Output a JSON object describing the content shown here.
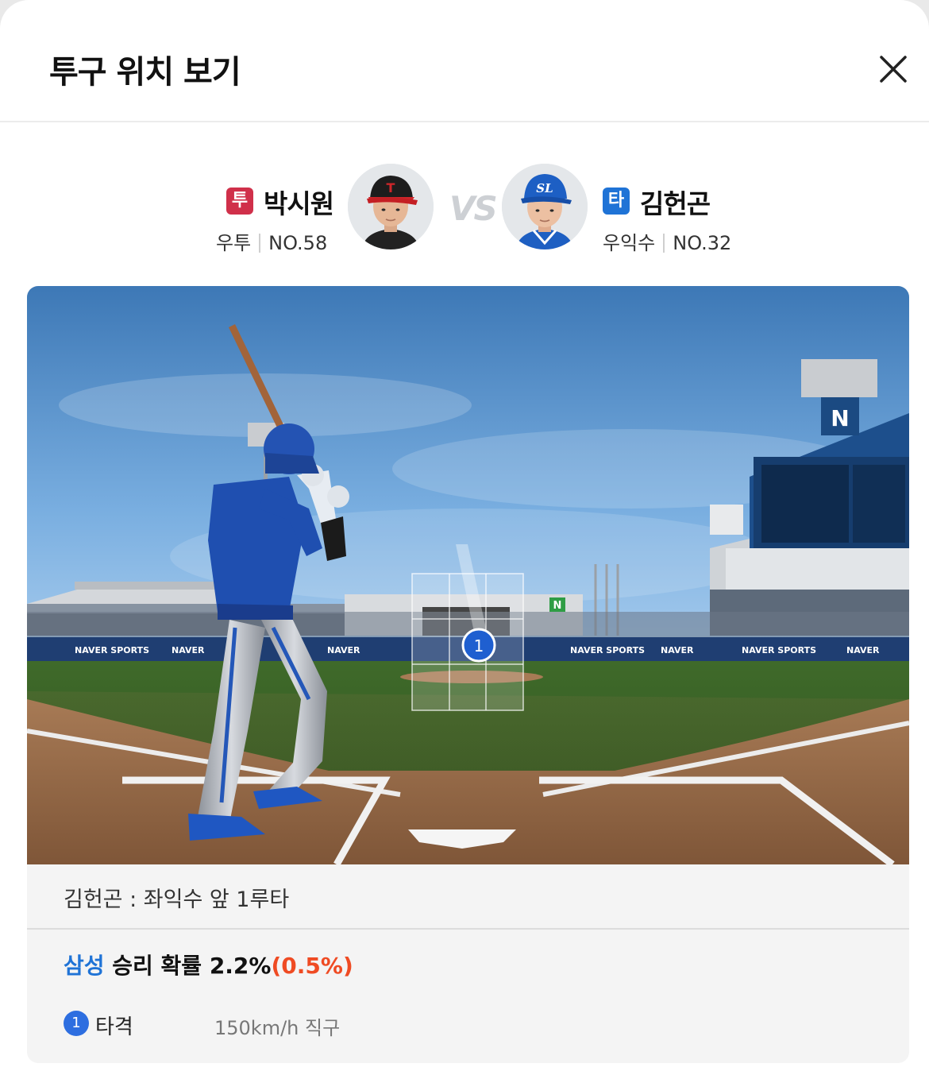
{
  "header": {
    "title": "투구 위치 보기",
    "close_label": "close"
  },
  "pitcher": {
    "role_badge": "투",
    "name": "박시원",
    "throw": "우투",
    "number": "NO.58",
    "badge_color": "#d0304a"
  },
  "vs_label": "VS",
  "batter": {
    "role_badge": "타",
    "name": "김헌곤",
    "bat": "우익수",
    "number": "NO.32",
    "badge_color": "#1f73d6"
  },
  "field": {
    "ad_boards": [
      "NAVER SPORTS",
      "NAVER",
      "NAVER",
      "NAVER SPORTS",
      "NAVER",
      "NAVER SPORTS",
      "NAVER"
    ],
    "scoreboard_logo": "N",
    "pitch_marker": "1"
  },
  "play": {
    "result_text": "김헌곤 : 좌익수 앞 1루타",
    "win_prob_team": "삼성",
    "win_prob_label": " 승리 확률 2.2%",
    "win_prob_delta": "(0.5%)"
  },
  "pitches": [
    {
      "num": "1",
      "type": "타격",
      "info": "150km/h  직구"
    }
  ],
  "colors": {
    "team_blue": "#1f73d6",
    "delta_red": "#ef4b23",
    "marker_blue": "#2d6ee0"
  }
}
